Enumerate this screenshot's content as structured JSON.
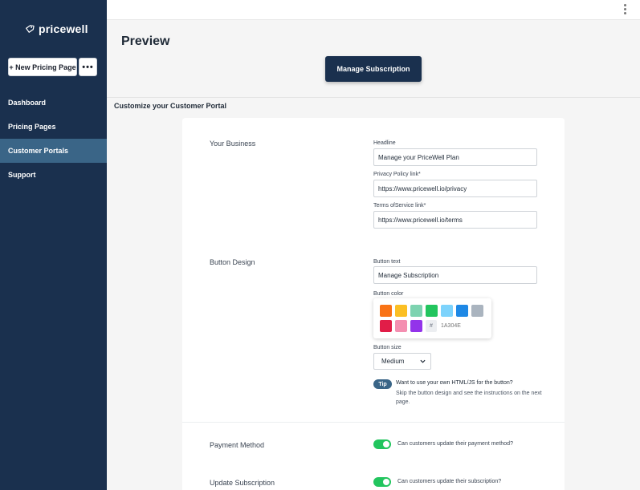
{
  "sidebar": {
    "logo_text": "pricewell",
    "new_button_label": "+ New Pricing Page",
    "more_button_label": "•••",
    "items": [
      {
        "label": "Dashboard",
        "active": false
      },
      {
        "label": "Pricing Pages",
        "active": false
      },
      {
        "label": "Customer Portals",
        "active": true
      },
      {
        "label": "Support",
        "active": false
      }
    ]
  },
  "preview": {
    "title": "Preview",
    "button_label": "Manage Subscription"
  },
  "customize_heading": "Customize your Customer Portal",
  "business": {
    "section_label": "Your Business",
    "headline_label": "Headline",
    "headline_value": "Manage your PriceWell Plan",
    "privacy_label": "Privacy Policy link*",
    "privacy_value": "https://www.pricewell.io/privacy",
    "terms_label": "Terms ofService link*",
    "terms_value": "https://www.pricewell.io/terms"
  },
  "button_design": {
    "section_label": "Button Design",
    "text_label": "Button text",
    "text_value": "Manage Subscription",
    "color_label": "Button color",
    "colors": [
      "#f97316",
      "#fbbf24",
      "#7dd3b0",
      "#22c55e",
      "#7dd3fc",
      "#1e88e5",
      "#aab4bf",
      "#e11d48",
      "#f48fb1",
      "#9333ea"
    ],
    "hash_symbol": "#",
    "hex_placeholder": "1A304E",
    "size_label": "Button size",
    "size_value": "Medium",
    "tip_badge": "Tip",
    "tip_title": "Want to use your own HTML/JS for the button?",
    "tip_text": "Skip the button design and see the instructions on the next page."
  },
  "payment_method": {
    "section_label": "Payment Method",
    "toggle_text": "Can customers update their payment method?",
    "enabled": true
  },
  "update_subscription": {
    "section_label": "Update Subscription",
    "toggle_text": "Can customers update their subscription?",
    "enabled": true
  },
  "accent_color": "#1a304e"
}
